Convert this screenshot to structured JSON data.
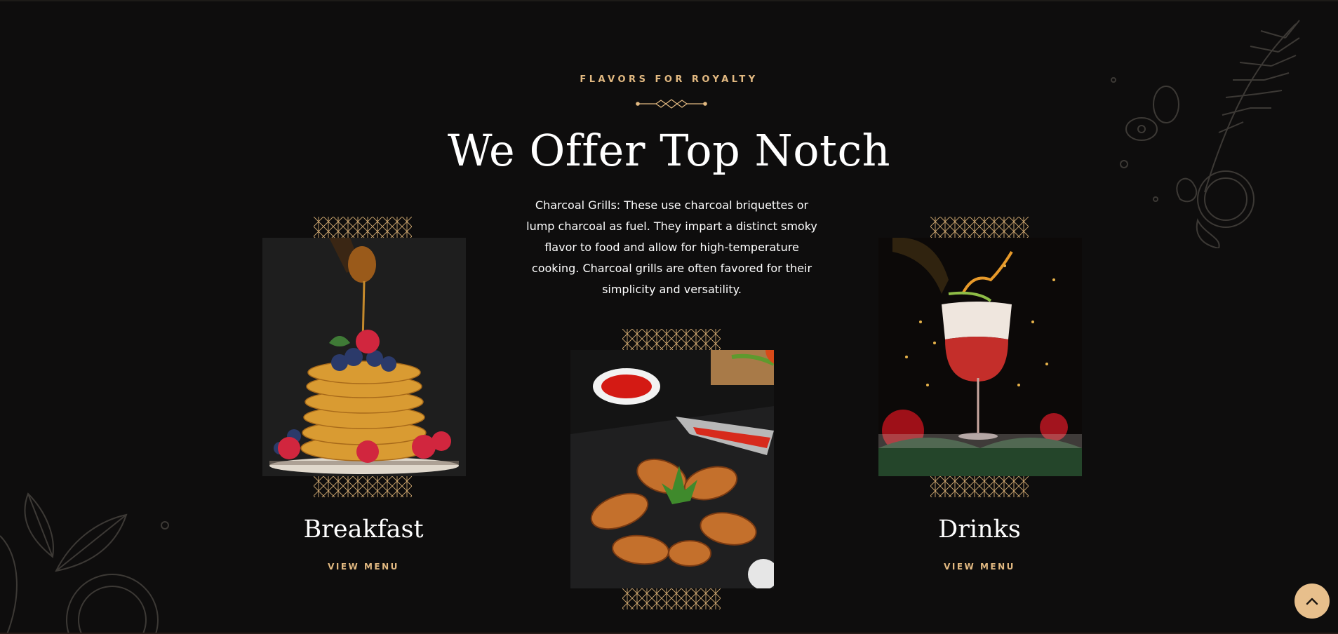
{
  "section": {
    "subtitle": "FLAVORS FOR ROYALTY",
    "title": "We Offer Top Notch",
    "description": "Charcoal Grills: These use charcoal briquettes or lump charcoal as fuel. They impart a distinct smoky flavor to food and allow for high-temperature cooking. Charcoal grills are often favored for their simplicity and versatility."
  },
  "cards": [
    {
      "title": "Breakfast",
      "link": "VIEW MENU",
      "image": "pancakes-with-honey-photo"
    },
    {
      "title": "",
      "link": "",
      "image": "grilled-chicken-wings-photo"
    },
    {
      "title": "Drinks",
      "link": "VIEW MENU",
      "image": "red-cocktail-photo"
    }
  ],
  "icons": {
    "back_to_top": "chevron-up-icon",
    "divider": "diamond-ornament-icon"
  },
  "colors": {
    "background": "#0e0d0d",
    "accent": "#e2b981",
    "back_to_top_bg": "#e7bf8c",
    "text": "#ffffff"
  }
}
